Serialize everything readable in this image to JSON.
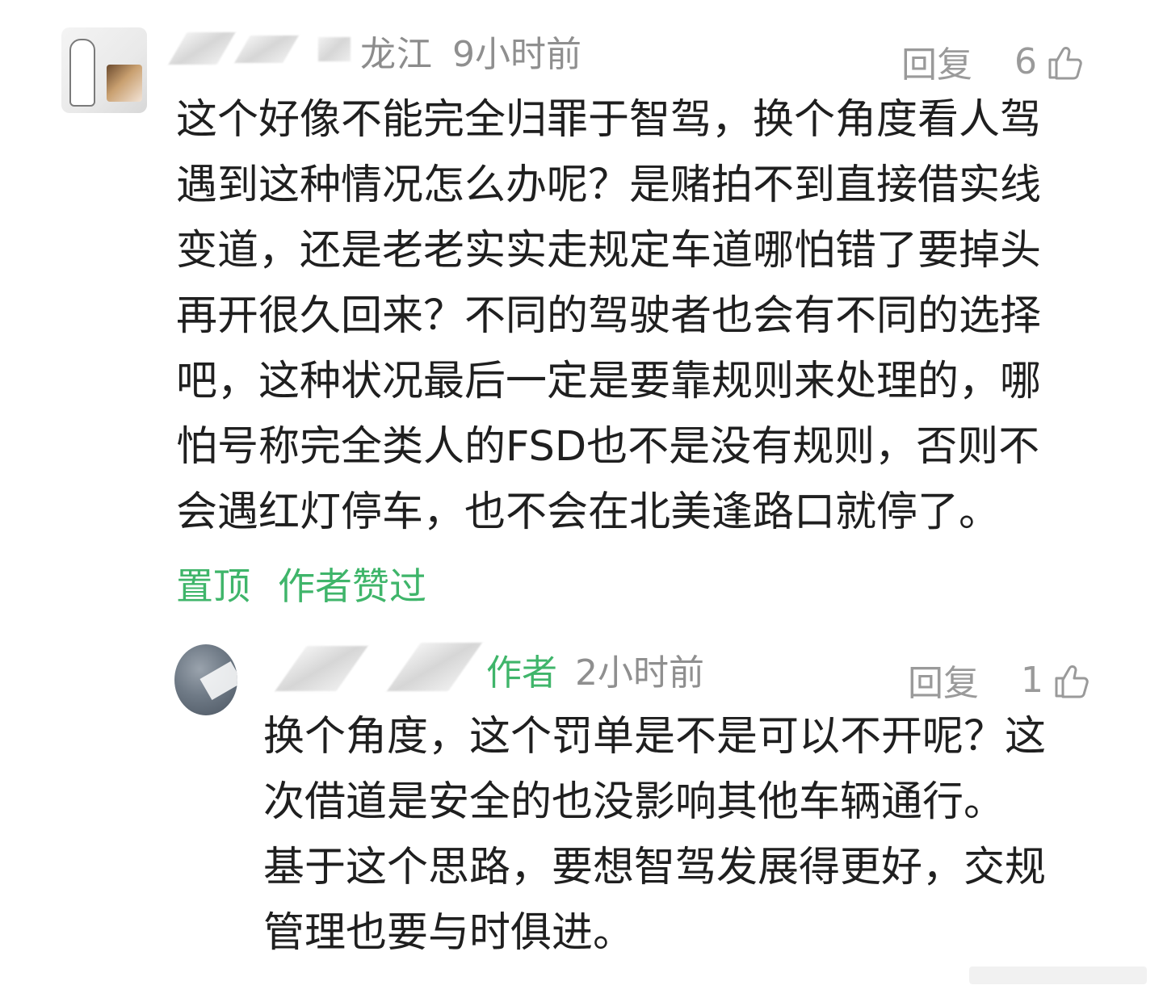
{
  "main_comment": {
    "location_suffix": "龙江",
    "time": "9小时前",
    "reply_label": "回复",
    "like_count": "6",
    "text": "这个好像不能完全归罪于智驾，换个角度看人驾\n遇到这种情况怎么办呢？是赌拍不到直接借实线\n变道，还是老老实实走规定车道哪怕错了要掉头\n再开很久回来？不同的驾驶者也会有不同的选择\n吧，这种状况最后一定是要靠规则来处理的，哪\n怕号称完全类人的FSD也不是没有规则，否则不\n会遇红灯停车，也不会在北美逢路口就停了。",
    "tags": [
      "置顶",
      "作者赞过"
    ]
  },
  "reply_comment": {
    "author_tag": "作者",
    "time": "2小时前",
    "reply_label": "回复",
    "like_count": "1",
    "text": "换个角度，这个罚单是不是可以不开呢？这\n次借道是安全的也没影响其他车辆通行。\n基于这个思路，要想智驾发展得更好，交规\n管理也要与时俱进。"
  },
  "colors": {
    "accent_green": "#3fb56a",
    "meta_gray": "#8f8f8f",
    "text_dark": "#1f1f1f"
  },
  "icons": {
    "like": "thumbs-up-icon"
  }
}
